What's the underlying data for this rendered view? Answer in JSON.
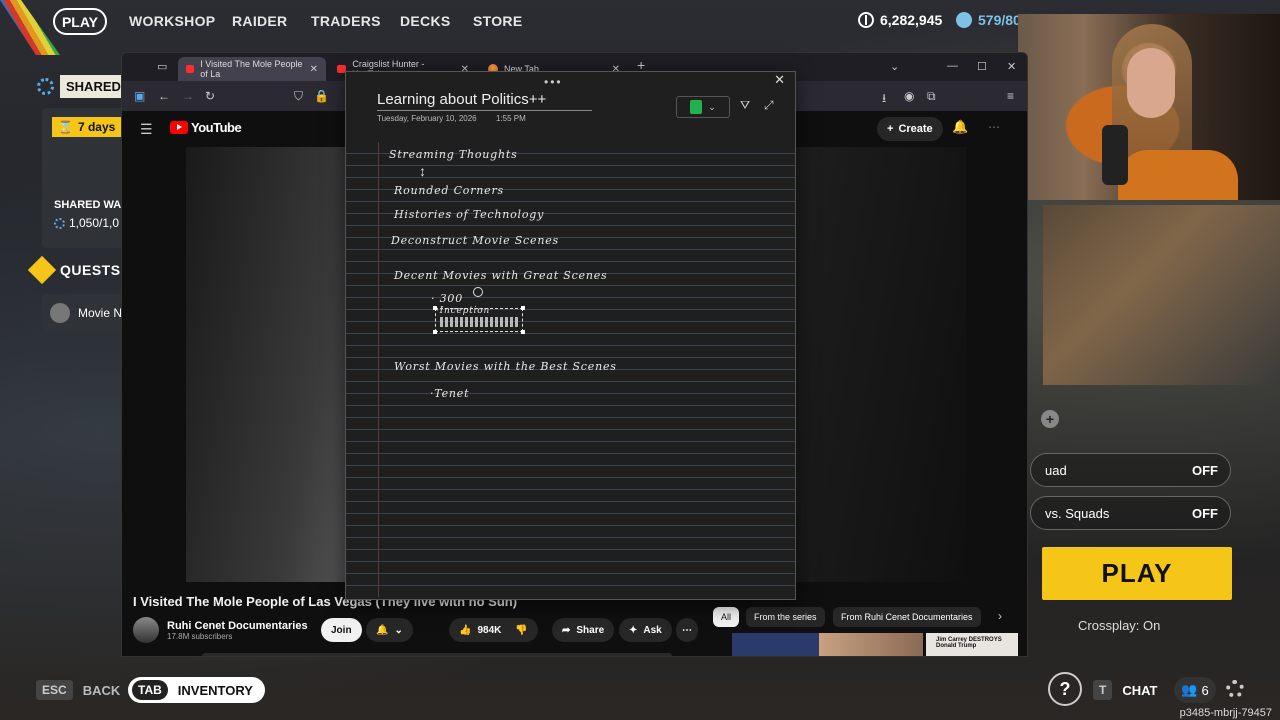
{
  "game": {
    "nav": {
      "play": "PLAY",
      "items": [
        "WORKSHOP",
        "RAIDER",
        "TRADERS",
        "DECKS",
        "STORE"
      ],
      "coins": "6,282,945",
      "tokens": "579/80"
    },
    "left_panel": {
      "shared_label": "SHARED W",
      "days": "7 days",
      "shared_wa": "SHARED WA",
      "shared_count": "1,050/1,0",
      "quests_label": "QUESTS",
      "quest_item": "Movie N"
    },
    "right_panel": {
      "squad_label": "uad",
      "squad_value": "OFF",
      "vs_squads_label": "vs. Squads",
      "vs_squads_value": "OFF",
      "play_button": "PLAY",
      "crossplay": "Crossplay: On"
    },
    "bottom": {
      "esc_key": "ESC",
      "back_label": "BACK",
      "tab_key": "TAB",
      "inventory_label": "INVENTORY",
      "help": "?",
      "chat_key": "T",
      "chat_label": "CHAT",
      "friends_count": "6",
      "player_id": "p3485-mbrjj-79457"
    }
  },
  "browser": {
    "tabs": [
      {
        "title": "I Visited The Mole People of La",
        "icon": "youtube-icon"
      },
      {
        "title": "Craigslist Hunter - YouTube",
        "icon": "youtube-icon"
      },
      {
        "title": "New Tab",
        "icon": "firefox-icon"
      }
    ],
    "youtube": {
      "logo": "YouTube",
      "create": "Create",
      "video_title": "I Visited The Mole People of Las Vegas (They live with no Sun)",
      "channel_name": "Ruhi Cenet Documentaries",
      "subscribers": "17.8M subscribers",
      "join": "Join",
      "likes": "984K",
      "share": "Share",
      "ask": "Ask",
      "chips": [
        "All",
        "From the series",
        "From Ruhi Cenet Documentaries"
      ],
      "thumb_caption": "Jim Carrey DESTROYS Donald Trump"
    }
  },
  "notes": {
    "title": "Learning about Politics++",
    "date": "Tuesday, February 10, 2026",
    "time": "1:55 PM",
    "lines": {
      "streaming": "Streaming Thoughts",
      "rounded": "Rounded Corners",
      "histories": "Histories of Technology",
      "deconstruct": "Deconstruct Movie Scenes",
      "decent": "Decent Movies with Great Scenes",
      "m300": "· 300",
      "inception": "·Inception",
      "worst": "Worst Movies with the Best Scenes",
      "tenet": "·Tenet"
    }
  }
}
